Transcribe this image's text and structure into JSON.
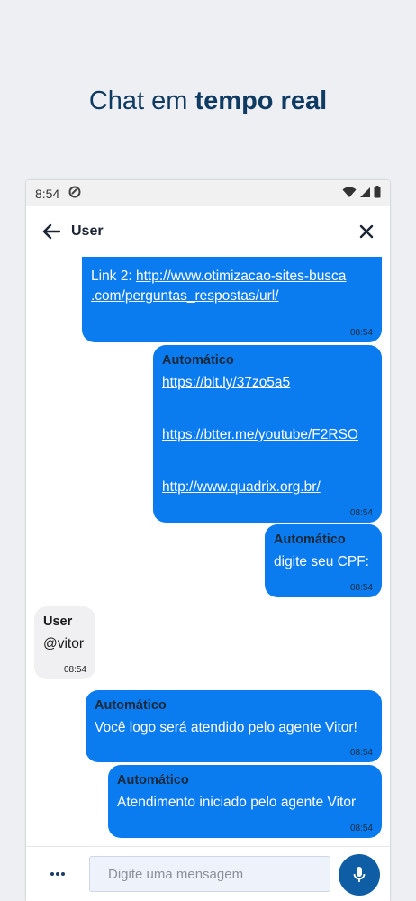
{
  "headline": {
    "part1": "Chat em",
    "part2": "tempo real"
  },
  "status_bar": {
    "time": "8:54"
  },
  "app_bar": {
    "title": "User"
  },
  "messages": [
    {
      "sender": "",
      "text_prefix": "Link 2: ",
      "link": "http://www.otimizacao-sites-busca.com/perguntas_respostas/url/",
      "link_line1": "http://www.otimizacao-sites-busca",
      "link_line2": ".com/perguntas_respostas/url/",
      "time": "08:54"
    },
    {
      "sender": "Automático",
      "links": [
        "https://bit.ly/37zo5a5",
        "https://btter.me/youtube/F2RSO",
        "http://www.quadrix.org.br/"
      ],
      "time": "08:54"
    },
    {
      "sender": "Automático",
      "text": "digite seu CPF:",
      "time": "08:54"
    },
    {
      "sender": "User",
      "text": "@vitor",
      "time": "08:54"
    },
    {
      "sender": "Automático",
      "text": "Você logo será atendido pelo agente Vitor!",
      "time": "08:54"
    },
    {
      "sender": "Automático",
      "text": "Atendimento iniciado pelo agente Vitor",
      "time": "08:54"
    }
  ],
  "input": {
    "placeholder": "Digite uma mensagem",
    "value": ""
  },
  "colors": {
    "bubble_agent": "#0a7cf0",
    "bubble_user": "#f0f0f2",
    "mic_button": "#0f5da4",
    "headline": "#0f3b62"
  }
}
